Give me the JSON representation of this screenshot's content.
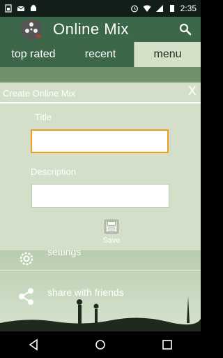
{
  "status_bar": {
    "time": "2:35",
    "left_icons": [
      "sim-icon",
      "mail-icon",
      "android-icon"
    ],
    "right_icons": [
      "alarm-icon",
      "wifi-icon",
      "signal-icon",
      "battery-icon"
    ]
  },
  "app_bar": {
    "title": "Online Mix",
    "logo_icon": "film-reel-icon",
    "search_icon": "search-icon"
  },
  "tabs": [
    {
      "label": "top rated",
      "active": false
    },
    {
      "label": "recent",
      "active": false
    },
    {
      "label": "menu",
      "active": true
    }
  ],
  "menu": {
    "items": [
      {
        "label": "settings",
        "icon": "gear-icon"
      },
      {
        "label": "share with friends",
        "icon": "share-icon"
      }
    ]
  },
  "dialog": {
    "title": "Create Online Mix",
    "close_glyph": "X",
    "title_field": {
      "label": "Title",
      "value": "",
      "placeholder": ""
    },
    "description_field": {
      "label": "Description",
      "value": "",
      "placeholder": ""
    },
    "save_label": "Save"
  },
  "nav_bar": {
    "icons": [
      "back-icon",
      "home-icon",
      "recents-icon"
    ]
  },
  "colors": {
    "app_bar": "#3c6748",
    "tab_active": "#d4e0c8",
    "dialog_bg": "#d3dfc9",
    "focus": "#f29b1c"
  }
}
